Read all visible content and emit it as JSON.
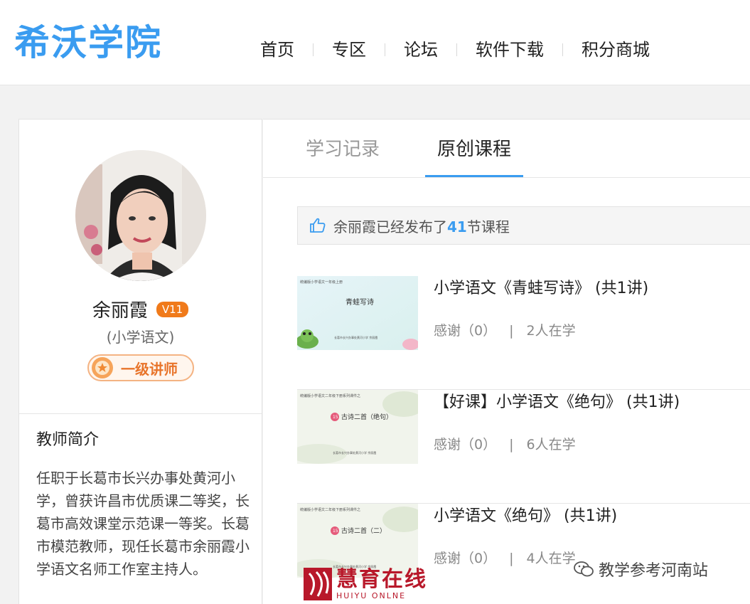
{
  "header": {
    "logo": "希沃学院",
    "nav": [
      {
        "label": "首页"
      },
      {
        "label": "专区"
      },
      {
        "label": "论坛"
      },
      {
        "label": "软件下载"
      },
      {
        "label": "积分商城"
      }
    ]
  },
  "profile": {
    "name": "余丽霞",
    "vip_level": "V11",
    "subject": "(小学语文)",
    "rank": "一级讲师",
    "intro_title": "教师简介",
    "intro_text": "任职于长葛市长兴办事处黄河小学，曾获许昌市优质课二等奖，长葛市高效课堂示范课一等奖。长葛市模范教师，现任长葛市余丽霞小学语文名师工作室主持人。"
  },
  "tabs": [
    {
      "label": "学习记录",
      "active": false
    },
    {
      "label": "原创课程",
      "active": true
    }
  ],
  "notice": {
    "prefix": "余丽霞已经发布了",
    "count": "41",
    "suffix": "节课程"
  },
  "courses": [
    {
      "title": "小学语文《青蛙写诗》 (共1讲)",
      "thanks": "感谢（0）",
      "learners": "2人在学",
      "thumb": {
        "header": "统编版小学语文一年级上册",
        "title": "青蛙写诗",
        "footer": "长葛市长兴办事处黄河小学 余丽霞"
      }
    },
    {
      "title": "【好课】小学语文《绝句》 (共1讲)",
      "thanks": "感谢（0）",
      "learners": "6人在学",
      "thumb": {
        "header": "统编版小学语文二年级下册系列课件之",
        "number": "15",
        "title": "古诗二首（绝句）",
        "footer": "长葛市长兴办事处黄河小学 余丽霞"
      }
    },
    {
      "title": "小学语文《绝句》 (共1讲)",
      "thanks": "感谢（0）",
      "learners": "4人在学",
      "thumb": {
        "header": "统编版小学语文二年级下册系列课件之",
        "number": "15",
        "title": "古诗二首（二）",
        "footer": "长葛市长兴办事处黄河小学 余丽霞"
      }
    }
  ],
  "watermarks": {
    "left_main": "慧育在线",
    "left_sub": "HUIYU ONLNE",
    "right": "教学参考河南站"
  },
  "colors": {
    "accent": "#3a9cf0",
    "vip_badge": "#f07a1a",
    "rank": "#e8742a",
    "brand_red": "#b8182a"
  }
}
